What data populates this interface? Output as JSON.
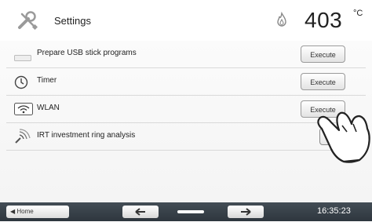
{
  "header": {
    "title": "Settings",
    "temperature": "403",
    "unit": "°C",
    "icons": [
      "wrench-screwdriver-icon",
      "flame-icon"
    ]
  },
  "rows": [
    {
      "label": "Prepare USB stick programs",
      "icon": "usb-stick-icon",
      "button": "Execute"
    },
    {
      "label": "Timer",
      "icon": "clock-icon",
      "button": "Execute"
    },
    {
      "label": "WLAN",
      "icon": "wifi-icon",
      "button": "Execute"
    },
    {
      "label": "IRT investment ring analysis",
      "icon": "irt-sensor-icon",
      "toggle": {
        "on_label": "I",
        "off_label": "O",
        "selected": "O"
      }
    }
  ],
  "bottom_bar": {
    "home_label": "Home",
    "time": "16:35:23",
    "icons": [
      "arrow-left-icon",
      "scrollbar-icon",
      "arrow-right-icon"
    ]
  },
  "colors": {
    "bottom_bar": "#36404a",
    "toggle_selected": "#1f6fc2"
  }
}
